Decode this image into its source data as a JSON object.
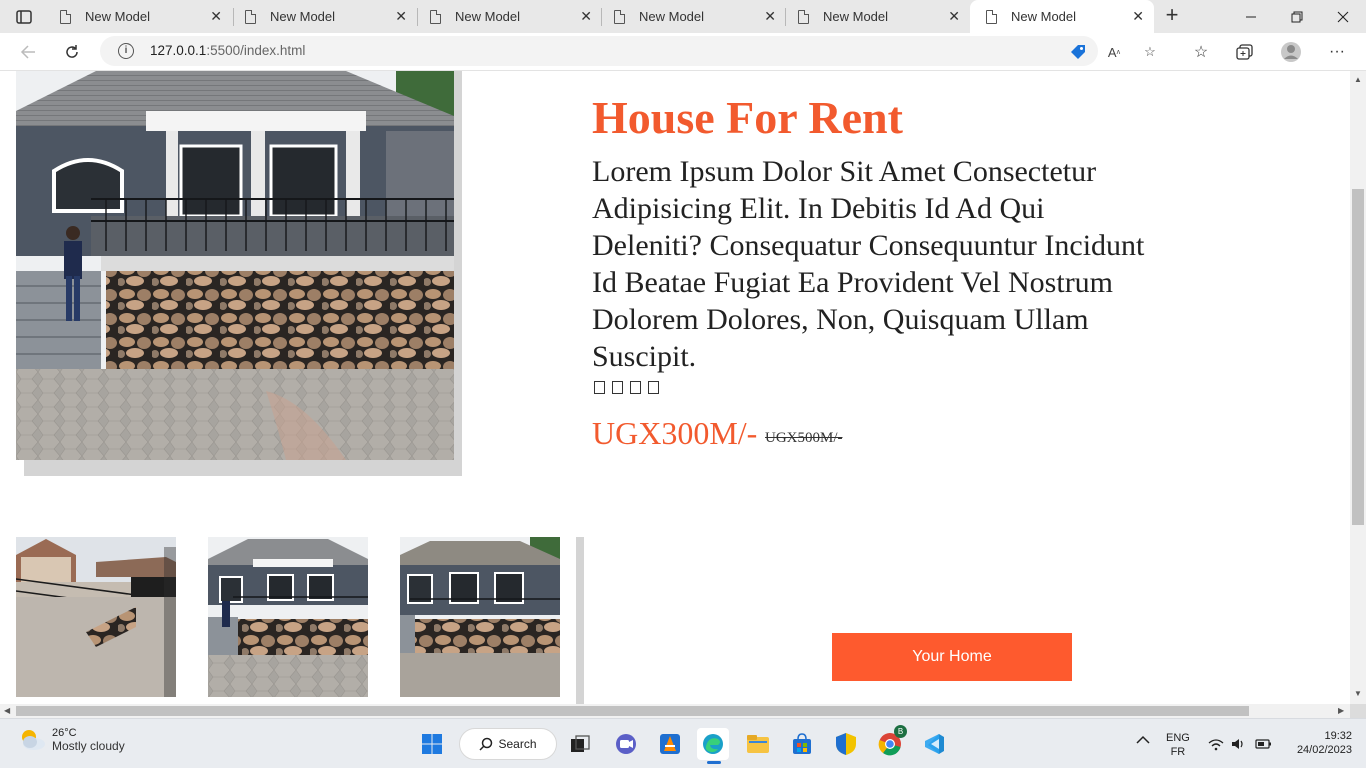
{
  "browser": {
    "tabs": [
      {
        "title": "New Model",
        "active": false
      },
      {
        "title": "New Model",
        "active": false
      },
      {
        "title": "New Model",
        "active": false
      },
      {
        "title": "New Model",
        "active": false
      },
      {
        "title": "New Model",
        "active": false
      },
      {
        "title": "New Model",
        "active": true
      }
    ],
    "url_host": "127.0.0.1",
    "url_path": ":5500/index.html"
  },
  "page": {
    "title": "House For Rent",
    "description": "Lorem Ipsum Dolor Sit Amet Consectetur Adipisicing Elit. In Debitis Id Ad Qui Deleniti? Consequatur Consequuntur Incidunt Id Beatae Fugiat Ea Provident Vel Nostrum Dolorem Dolores, Non, Quisquam Ullam Suscipit.",
    "stars": [
      "star-icon",
      "star-icon",
      "star-icon",
      "star-icon"
    ],
    "price": "UGX300M/-",
    "old_price": "UGX500M/-",
    "cta_label": "Your Home",
    "accent_color": "#f25a2e",
    "button_color": "#fe5a2e"
  },
  "taskbar": {
    "weather_temp": "26°C",
    "weather_condition": "Mostly cloudy",
    "search_label": "Search",
    "chrome_badge": "B",
    "lang_top": "ENG",
    "lang_bottom": "FR",
    "time": "19:32",
    "date": "24/02/2023"
  }
}
